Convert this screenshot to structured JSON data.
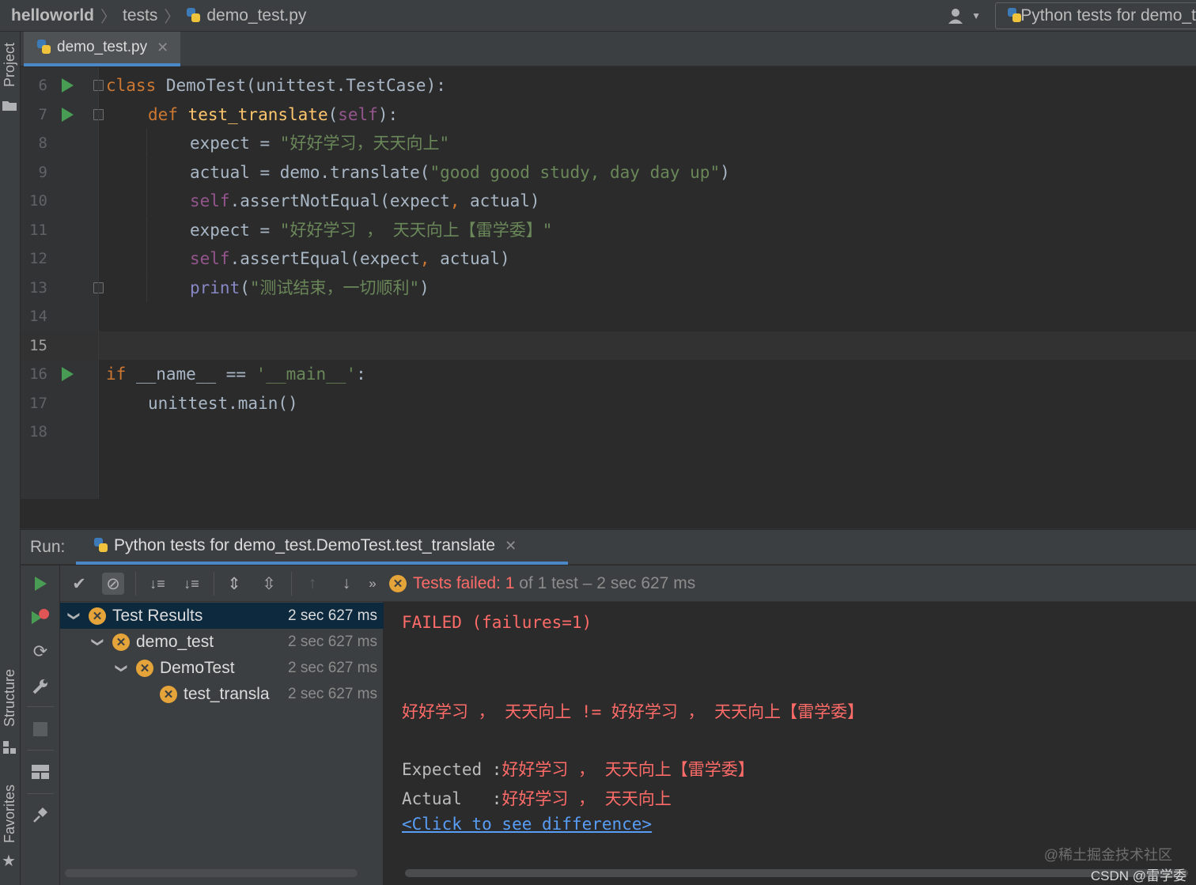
{
  "breadcrumb": {
    "project": "helloworld",
    "folder": "tests",
    "file": "demo_test.py"
  },
  "run_config": "Python tests for demo_t",
  "side_labels": {
    "project": "Project",
    "structure": "Structure",
    "favorites": "Favorites"
  },
  "editor": {
    "tab_label": "demo_test.py",
    "lines": [
      {
        "n": "6",
        "has_run": true,
        "fold": true,
        "indent": 0,
        "tokens": [
          {
            "t": "class ",
            "c": "kw"
          },
          {
            "t": "DemoTest(unittest.TestCase):",
            "c": "plain"
          }
        ]
      },
      {
        "n": "7",
        "has_run": true,
        "fold": true,
        "indent": 1,
        "tokens": [
          {
            "t": "def ",
            "c": "kw"
          },
          {
            "t": "test_translate",
            "c": "fn"
          },
          {
            "t": "(",
            "c": "plain"
          },
          {
            "t": "self",
            "c": "slf"
          },
          {
            "t": "):",
            "c": "plain"
          }
        ]
      },
      {
        "n": "8",
        "has_run": false,
        "fold": false,
        "indent": 2,
        "tokens": [
          {
            "t": "expect = ",
            "c": "plain"
          },
          {
            "t": "\"好好学习，天天向上\"",
            "c": "str"
          }
        ]
      },
      {
        "n": "9",
        "has_run": false,
        "fold": false,
        "indent": 2,
        "tokens": [
          {
            "t": "actual = demo.translate(",
            "c": "plain"
          },
          {
            "t": "\"good good study, day day up\"",
            "c": "str"
          },
          {
            "t": ")",
            "c": "plain"
          }
        ]
      },
      {
        "n": "10",
        "has_run": false,
        "fold": false,
        "indent": 2,
        "tokens": [
          {
            "t": "self",
            "c": "slf"
          },
          {
            "t": ".assertNotEqual(expect",
            "c": "plain"
          },
          {
            "t": ", ",
            "c": "kw"
          },
          {
            "t": "actual)",
            "c": "plain"
          }
        ]
      },
      {
        "n": "11",
        "has_run": false,
        "fold": false,
        "indent": 2,
        "tokens": [
          {
            "t": "expect = ",
            "c": "plain"
          },
          {
            "t": "\"好好学习 ， 天天向上【雷学委】\"",
            "c": "str"
          }
        ]
      },
      {
        "n": "12",
        "has_run": false,
        "fold": false,
        "indent": 2,
        "tokens": [
          {
            "t": "self",
            "c": "slf"
          },
          {
            "t": ".assertEqual(expect",
            "c": "plain"
          },
          {
            "t": ", ",
            "c": "kw"
          },
          {
            "t": "actual)",
            "c": "plain"
          }
        ]
      },
      {
        "n": "13",
        "has_run": false,
        "fold": true,
        "indent": 2,
        "tokens": [
          {
            "t": "print",
            "c": "bi"
          },
          {
            "t": "(",
            "c": "plain"
          },
          {
            "t": "\"测试结束，一切顺利\"",
            "c": "str"
          },
          {
            "t": ")",
            "c": "plain"
          }
        ]
      },
      {
        "n": "14",
        "has_run": false,
        "fold": false,
        "indent": 0,
        "tokens": []
      },
      {
        "n": "15",
        "has_run": false,
        "fold": false,
        "indent": 0,
        "current": true,
        "tokens": []
      },
      {
        "n": "16",
        "has_run": true,
        "fold": false,
        "indent": 0,
        "tokens": [
          {
            "t": "if ",
            "c": "kw"
          },
          {
            "t": "__name__ == ",
            "c": "plain"
          },
          {
            "t": "'__main__'",
            "c": "str"
          },
          {
            "t": ":",
            "c": "plain"
          }
        ]
      },
      {
        "n": "17",
        "has_run": false,
        "fold": false,
        "indent": 1,
        "tokens": [
          {
            "t": "unittest.main()",
            "c": "plain"
          }
        ]
      },
      {
        "n": "18",
        "has_run": false,
        "fold": false,
        "indent": 0,
        "tokens": []
      }
    ]
  },
  "run_panel": {
    "label": "Run:",
    "tab_label": "Python tests for demo_test.DemoTest.test_translate",
    "status": {
      "failed_text": "Tests failed: 1",
      "rest_text": " of 1 test – 2 sec 627 ms"
    },
    "tree": [
      {
        "label": "Test Results",
        "time": "2 sec 627 ms",
        "level": 0,
        "expanded": true,
        "selected": true
      },
      {
        "label": "demo_test",
        "time": "2 sec 627 ms",
        "level": 1,
        "expanded": true,
        "selected": false
      },
      {
        "label": "DemoTest",
        "time": "2 sec 627 ms",
        "level": 2,
        "expanded": true,
        "selected": false
      },
      {
        "label": "test_transla",
        "time": "2 sec 627 ms",
        "level": 3,
        "expanded": null,
        "selected": false
      }
    ],
    "console": {
      "failed": "FAILED (failures=1)",
      "assertion": "好好学习 ， 天天向上 != 好好学习 ， 天天向上【雷学委】",
      "expected_label": "Expected :",
      "expected_value": "好好学习 ， 天天向上【雷学委】",
      "actual_label": "Actual   :",
      "actual_value": "好好学习 ， 天天向上",
      "diff_link": "<Click to see difference>"
    }
  },
  "watermarks": {
    "top": "@稀土掘金技术社区",
    "bottom": "CSDN @雷学委"
  },
  "colors": {
    "accent": "#4a88c7",
    "run_green": "#499c54",
    "fail_orange": "#e5a43a",
    "error_red": "#ff6b68",
    "link_blue": "#589df6"
  }
}
